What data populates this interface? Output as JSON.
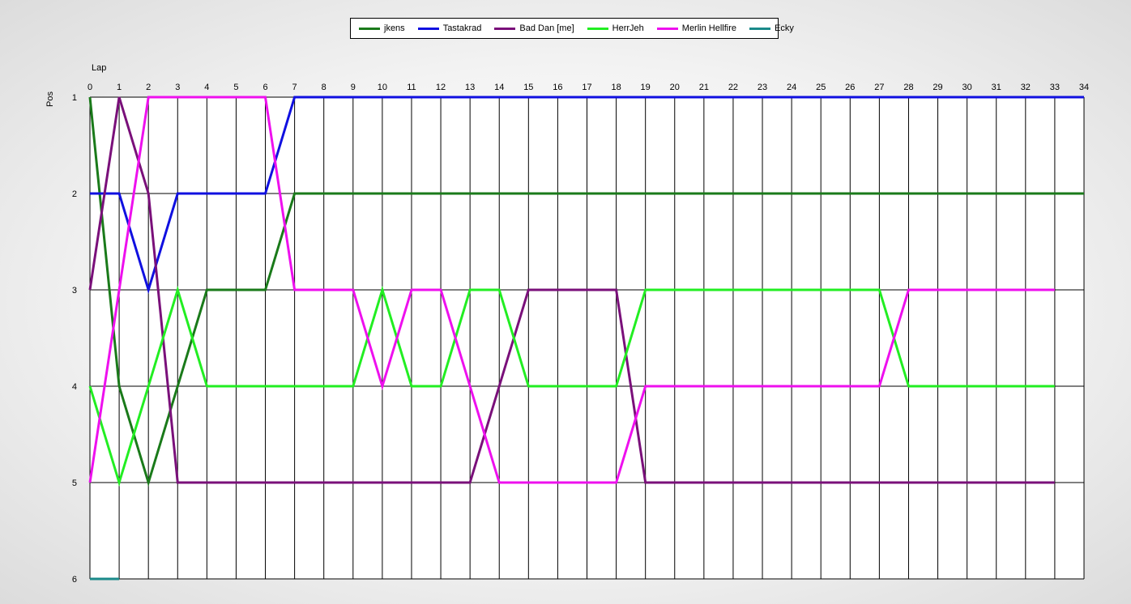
{
  "chart_data": {
    "type": "line",
    "xlabel": "Lap",
    "ylabel": "Pos",
    "xlim": [
      0,
      34
    ],
    "ylim": [
      1,
      6
    ],
    "y_inverted": true,
    "grid": true,
    "legend_position": "top-center",
    "x_ticks": [
      0,
      1,
      2,
      3,
      4,
      5,
      6,
      7,
      8,
      9,
      10,
      11,
      12,
      13,
      14,
      15,
      16,
      17,
      18,
      19,
      20,
      21,
      22,
      23,
      24,
      25,
      26,
      27,
      28,
      29,
      30,
      31,
      32,
      33,
      34
    ],
    "y_ticks": [
      1,
      2,
      3,
      4,
      5,
      6
    ],
    "series": [
      {
        "name": "jkens",
        "color": "#1a7a1a",
        "points": [
          [
            0,
            1
          ],
          [
            1,
            4
          ],
          [
            2,
            5
          ],
          [
            3,
            4
          ],
          [
            4,
            3
          ],
          [
            5,
            3
          ],
          [
            6,
            3
          ],
          [
            7,
            2
          ],
          [
            34,
            2
          ]
        ]
      },
      {
        "name": "Tastakrad",
        "color": "#1010e0",
        "points": [
          [
            0,
            2
          ],
          [
            1,
            2
          ],
          [
            2,
            3
          ],
          [
            3,
            2
          ],
          [
            4,
            2
          ],
          [
            5,
            2
          ],
          [
            6,
            2
          ],
          [
            7,
            1
          ],
          [
            34,
            1
          ]
        ]
      },
      {
        "name": "Bad Dan [me]",
        "color": "#7a107a",
        "points": [
          [
            0,
            3
          ],
          [
            1,
            1
          ],
          [
            2,
            2
          ],
          [
            3,
            5
          ],
          [
            13,
            5
          ],
          [
            14,
            4
          ],
          [
            15,
            3
          ],
          [
            16,
            3
          ],
          [
            17,
            3
          ],
          [
            18,
            3
          ],
          [
            19,
            5
          ],
          [
            33,
            5
          ]
        ]
      },
      {
        "name": "HerrJeh",
        "color": "#22ee22",
        "points": [
          [
            0,
            4
          ],
          [
            1,
            5
          ],
          [
            2,
            4
          ],
          [
            3,
            3
          ],
          [
            4,
            4
          ],
          [
            9,
            4
          ],
          [
            10,
            3
          ],
          [
            11,
            4
          ],
          [
            12,
            4
          ],
          [
            13,
            3
          ],
          [
            14,
            3
          ],
          [
            15,
            4
          ],
          [
            18,
            4
          ],
          [
            19,
            3
          ],
          [
            27,
            3
          ],
          [
            28,
            4
          ],
          [
            33,
            4
          ]
        ]
      },
      {
        "name": "Merlin Hellfire",
        "color": "#ee10ee",
        "points": [
          [
            0,
            5
          ],
          [
            1,
            3
          ],
          [
            2,
            1
          ],
          [
            6,
            1
          ],
          [
            7,
            3
          ],
          [
            9,
            3
          ],
          [
            10,
            4
          ],
          [
            11,
            3
          ],
          [
            12,
            3
          ],
          [
            13,
            4
          ],
          [
            14,
            5
          ],
          [
            18,
            5
          ],
          [
            19,
            4
          ],
          [
            27,
            4
          ],
          [
            28,
            3
          ],
          [
            33,
            3
          ]
        ]
      },
      {
        "name": "Ecky",
        "color": "#1a8a8a",
        "points": [
          [
            0,
            6
          ],
          [
            1,
            6
          ]
        ]
      }
    ]
  }
}
